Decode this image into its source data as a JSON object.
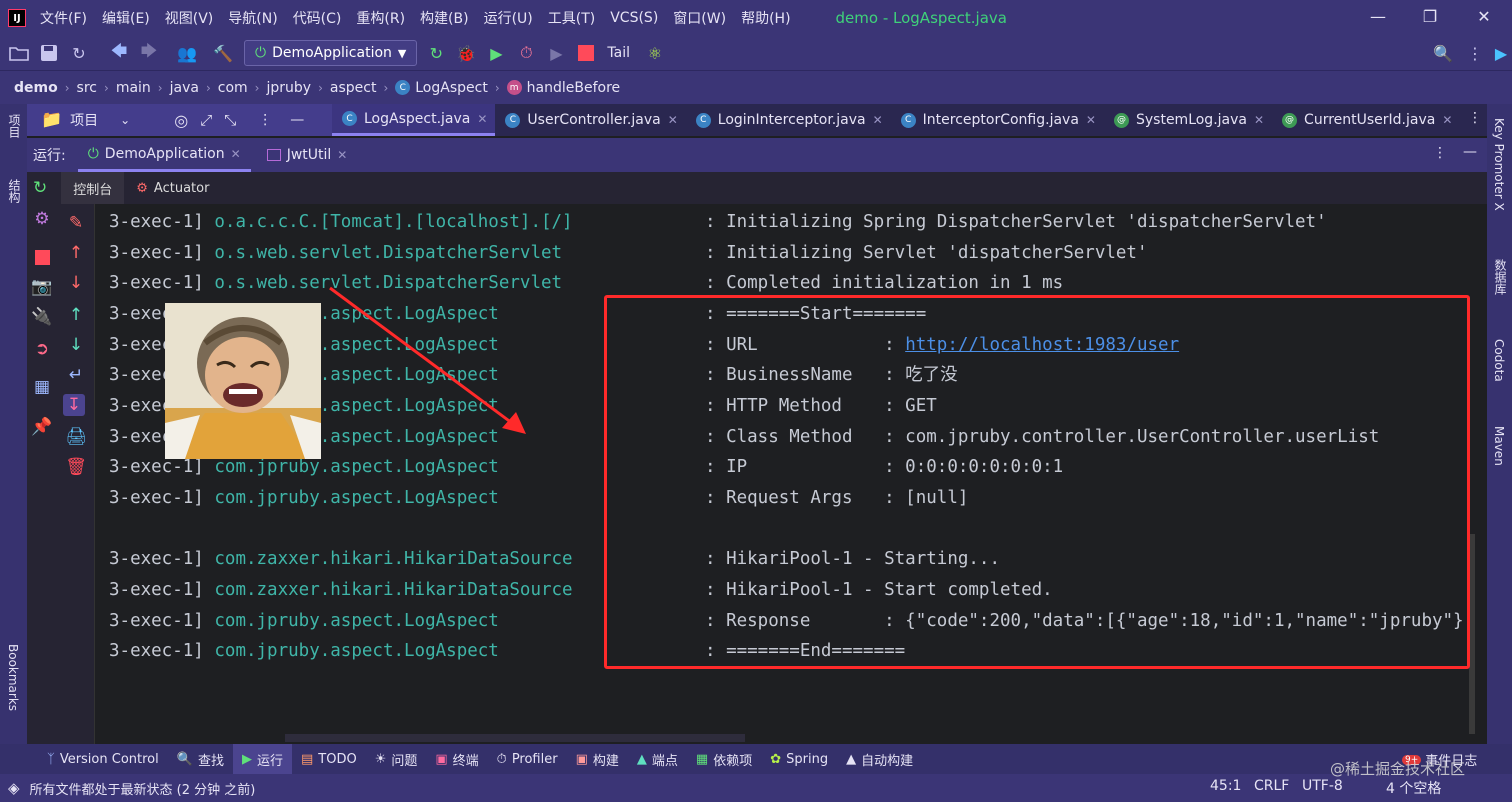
{
  "window": {
    "title": "demo - LogAspect.java",
    "menu": [
      "文件(F)",
      "编辑(E)",
      "视图(V)",
      "导航(N)",
      "代码(C)",
      "重构(R)",
      "构建(B)",
      "运行(U)",
      "工具(T)",
      "VCS(S)",
      "窗口(W)",
      "帮助(H)"
    ],
    "logo": "IJ"
  },
  "toolbar": {
    "run_config": "DemoApplication",
    "tail_label": "Tail"
  },
  "breadcrumb": {
    "items": [
      "demo",
      "src",
      "main",
      "java",
      "com",
      "jpruby",
      "aspect",
      "LogAspect",
      "handleBefore"
    ]
  },
  "project_panel": {
    "label": "项目"
  },
  "editor_tabs": [
    {
      "label": "LogAspect.java",
      "kind": "class"
    },
    {
      "label": "UserController.java",
      "kind": "class"
    },
    {
      "label": "LoginInterceptor.java",
      "kind": "class"
    },
    {
      "label": "InterceptorConfig.java",
      "kind": "class"
    },
    {
      "label": "SystemLog.java",
      "kind": "annotation"
    },
    {
      "label": "CurrentUserId.java",
      "kind": "annotation"
    }
  ],
  "run_panel": {
    "label": "运行:",
    "tabs": [
      "DemoApplication",
      "JwtUtil"
    ],
    "sub_tabs": [
      "控制台",
      "Actuator"
    ]
  },
  "console": {
    "lines": [
      {
        "thread": "3-exec-1]",
        "logger": "o.a.c.c.C.[Tomcat].[localhost].[/]",
        "msg": ": Initializing Spring DispatcherServlet 'dispatcherServlet'"
      },
      {
        "thread": "3-exec-1]",
        "logger": "o.s.web.servlet.DispatcherServlet",
        "msg": ": Initializing Servlet 'dispatcherServlet'"
      },
      {
        "thread": "3-exec-1]",
        "logger": "o.s.web.servlet.DispatcherServlet",
        "msg": ": Completed initialization in 1 ms"
      },
      {
        "thread": "3-exec-1]",
        "logger": "com.jpruby.aspect.LogAspect",
        "msg": ": =======Start======="
      },
      {
        "thread": "3-exec-1]",
        "logger": "com.jpruby.aspect.LogAspect",
        "msg": ": URL            : ",
        "link": "http://localhost:1983/user"
      },
      {
        "thread": "3-exec-1]",
        "logger": "com.jpruby.aspect.LogAspect",
        "msg": ": BusinessName   : 吃了没"
      },
      {
        "thread": "3-exec-1]",
        "logger": "com.jpruby.aspect.LogAspect",
        "msg": ": HTTP Method    : GET"
      },
      {
        "thread": "3-exec-1]",
        "logger": "com.jpruby.aspect.LogAspect",
        "msg": ": Class Method   : com.jpruby.controller.UserController.userList"
      },
      {
        "thread": "3-exec-1]",
        "logger": "com.jpruby.aspect.LogAspect",
        "msg": ": IP             : 0:0:0:0:0:0:0:1"
      },
      {
        "thread": "3-exec-1]",
        "logger": "com.jpruby.aspect.LogAspect",
        "msg": ": Request Args   : [null]"
      },
      {
        "thread": "",
        "logger": "",
        "msg": ""
      },
      {
        "thread": "3-exec-1]",
        "logger": "com.zaxxer.hikari.HikariDataSource",
        "msg": ": HikariPool-1 - Starting..."
      },
      {
        "thread": "3-exec-1]",
        "logger": "com.zaxxer.hikari.HikariDataSource",
        "msg": ": HikariPool-1 - Start completed."
      },
      {
        "thread": "3-exec-1]",
        "logger": "com.jpruby.aspect.LogAspect",
        "msg": ": Response       : {\"code\":200,\"data\":[{\"age\":18,\"id\":1,\"name\":\"jpruby\"},"
      },
      {
        "thread": "3-exec-1]",
        "logger": "com.jpruby.aspect.LogAspect",
        "msg": ": =======End======="
      }
    ]
  },
  "bottom_tabs": [
    "Version Control",
    "查找",
    "运行",
    "TODO",
    "问题",
    "终端",
    "Profiler",
    "构建",
    "端点",
    "依赖项",
    "Spring",
    "自动构建"
  ],
  "left_strip": {
    "project": "项目",
    "structure": "结构",
    "bookmarks": "Bookmarks"
  },
  "right_strip": [
    "Key Promoter X",
    "数据库",
    "Codota",
    "Maven"
  ],
  "status": {
    "message": "所有文件都处于最新状态 (2 分钟 之前)",
    "position": "45:1",
    "line_sep": "CRLF",
    "encoding": "UTF-8",
    "indent": "4 个空格",
    "event_log": "事件日志",
    "event_badge": "9+"
  },
  "watermark": "@稀土掘金技术社区",
  "colors": {
    "accent": "#3b3576",
    "highlight": "#ff2a2a",
    "logger": "#3fb5a8",
    "link": "#4c8fe6"
  }
}
